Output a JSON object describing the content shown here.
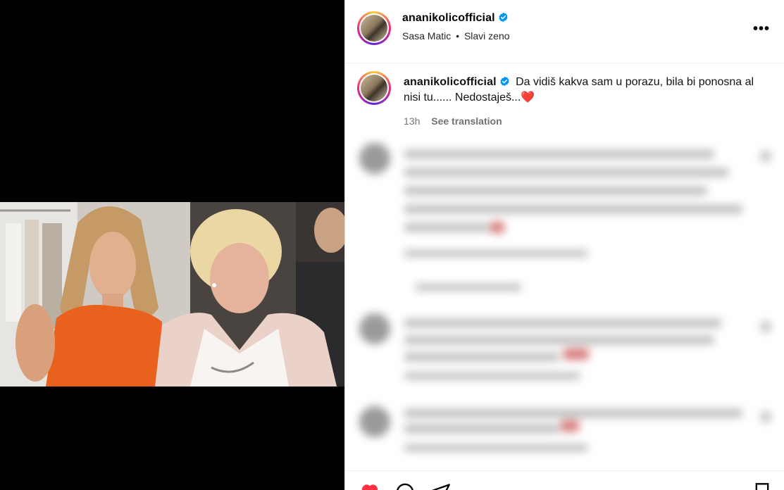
{
  "post": {
    "author": {
      "username": "ananikolicofficial",
      "verified": true,
      "audio_artist": "Sasa Matic",
      "audio_track": "Slavi zeno",
      "separator": "•"
    },
    "more_label": "•••",
    "caption": {
      "username": "ananikolicofficial",
      "text": "Da vidiš kakva sam u porazu, bila bi ponosna al nisi tu...... Nedostaješ...",
      "emoji": "❤️",
      "time": "13h",
      "see_translation": "See translation"
    },
    "comments": {
      "blurred": true,
      "count_visible": 3
    },
    "actions": {
      "like_icon": "heart-icon",
      "comment_icon": "comment-icon",
      "share_icon": "share-icon",
      "save_icon": "bookmark-icon"
    },
    "colors": {
      "verified": "#0095f6",
      "like": "#ff3040",
      "meta": "#737373"
    }
  }
}
